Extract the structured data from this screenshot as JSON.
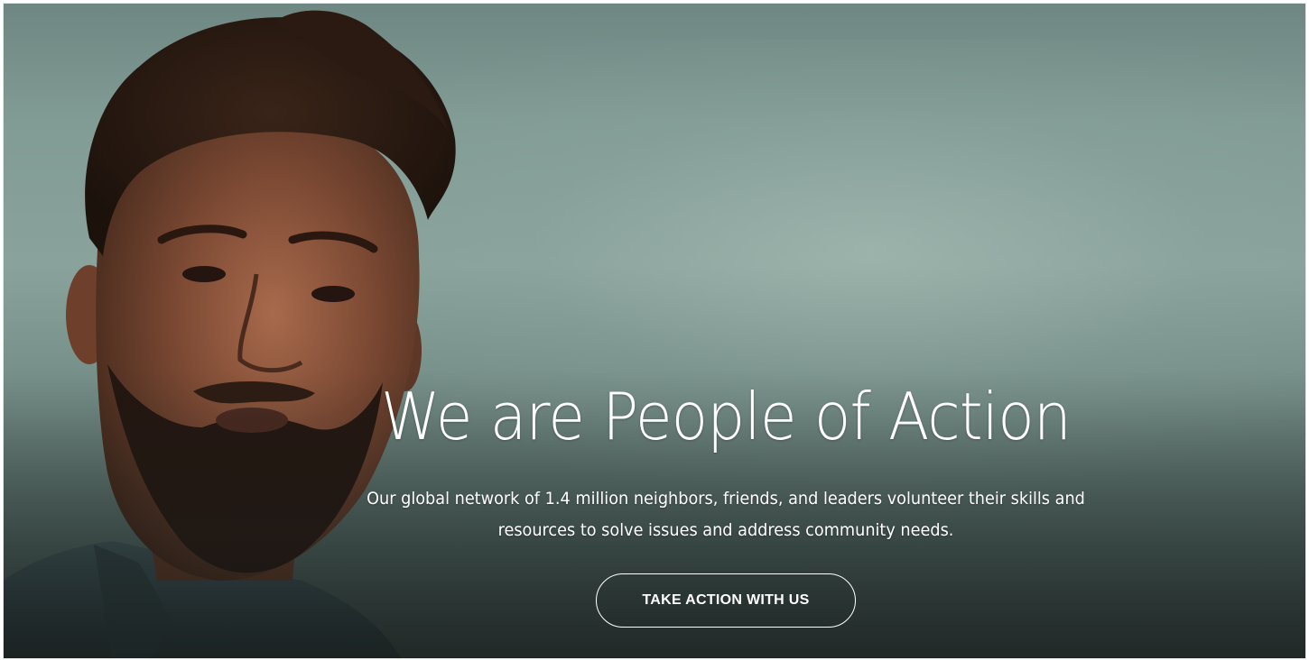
{
  "hero": {
    "title": "We are People of Action",
    "subtitle_line1": "Our global network of 1.4 million neighbors, friends, and leaders volunteer their skills and",
    "subtitle_line2": "resources to solve issues and address community needs.",
    "cta_label": "TAKE ACTION WITH US"
  },
  "colors": {
    "text": "#ffffff",
    "sky": "#819b95",
    "shadow": "#34423f"
  }
}
